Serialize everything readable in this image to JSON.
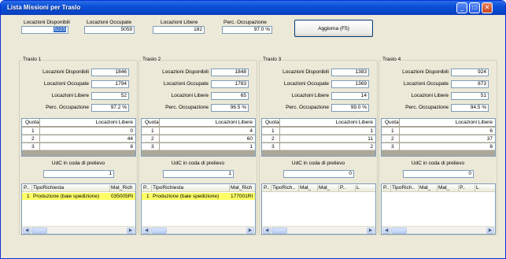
{
  "window": {
    "title": "Lista Missioni per Traslo"
  },
  "summary": {
    "disponibili": {
      "label": "Locazioni Disponibili",
      "value": "5223"
    },
    "occupate": {
      "label": "Locazioni Occupate",
      "value": "5059"
    },
    "libere": {
      "label": "Locazioni Libere",
      "value": "182"
    },
    "occupazione": {
      "label": "Perc. Occupazione",
      "value": "97.0 %"
    },
    "refresh_label": "Aggiorna (F5)"
  },
  "labels": {
    "disponibili": "Locazioni Disponibili",
    "occupate": "Locazioni Occupate",
    "libere": "Locazioni Libere",
    "occupazione": "Perc. Occupazione",
    "col_quota": "Quota",
    "col_libere": "Locazioni Libere",
    "udc": "UdC in coda di prelievo"
  },
  "traslos": [
    {
      "title": "Traslo 1",
      "disponibili": "1846",
      "occupate": "1794",
      "libere": "52",
      "occupazione": "97.2 %",
      "quote": [
        {
          "q": "1",
          "l": "0"
        },
        {
          "q": "2",
          "l": "44"
        },
        {
          "q": "3",
          "l": "8"
        }
      ],
      "udc": "1",
      "list_headers": [
        "P..",
        "TipoRichiesta",
        "Mat_Rich"
      ],
      "list_row": [
        "1",
        "Produzione (baie spedizione)",
        "035005RI"
      ]
    },
    {
      "title": "Traslo 2",
      "disponibili": "1848",
      "occupate": "1783",
      "libere": "65",
      "occupazione": "96.5 %",
      "quote": [
        {
          "q": "1",
          "l": "4"
        },
        {
          "q": "2",
          "l": "60"
        },
        {
          "q": "3",
          "l": "1"
        }
      ],
      "udc": "1",
      "list_headers": [
        "P..",
        "TipoRichiesta",
        "Mat_Rich"
      ],
      "list_row": [
        "1",
        "Produzione (baie spedizione)",
        "177001RI"
      ]
    },
    {
      "title": "Traslo 3",
      "disponibili": "1383",
      "occupate": "1369",
      "libere": "14",
      "occupazione": "99.0 %",
      "quote": [
        {
          "q": "1",
          "l": "1"
        },
        {
          "q": "2",
          "l": "11"
        },
        {
          "q": "3",
          "l": "2"
        }
      ],
      "udc": "0",
      "list_headers": [
        "P..",
        "TipoRich..",
        "Mat_",
        "Mat_",
        "P..",
        "L"
      ],
      "list_row": null
    },
    {
      "title": "Traslo 4",
      "disponibili": "924",
      "occupate": "873",
      "libere": "51",
      "occupazione": "94.5 %",
      "quote": [
        {
          "q": "1",
          "l": "6"
        },
        {
          "q": "2",
          "l": "37"
        },
        {
          "q": "3",
          "l": "8"
        }
      ],
      "udc": "0",
      "list_headers": [
        "P..",
        "TipoRich..",
        "Mat_",
        "Mat_",
        "P..",
        "L"
      ],
      "list_row": null
    }
  ]
}
